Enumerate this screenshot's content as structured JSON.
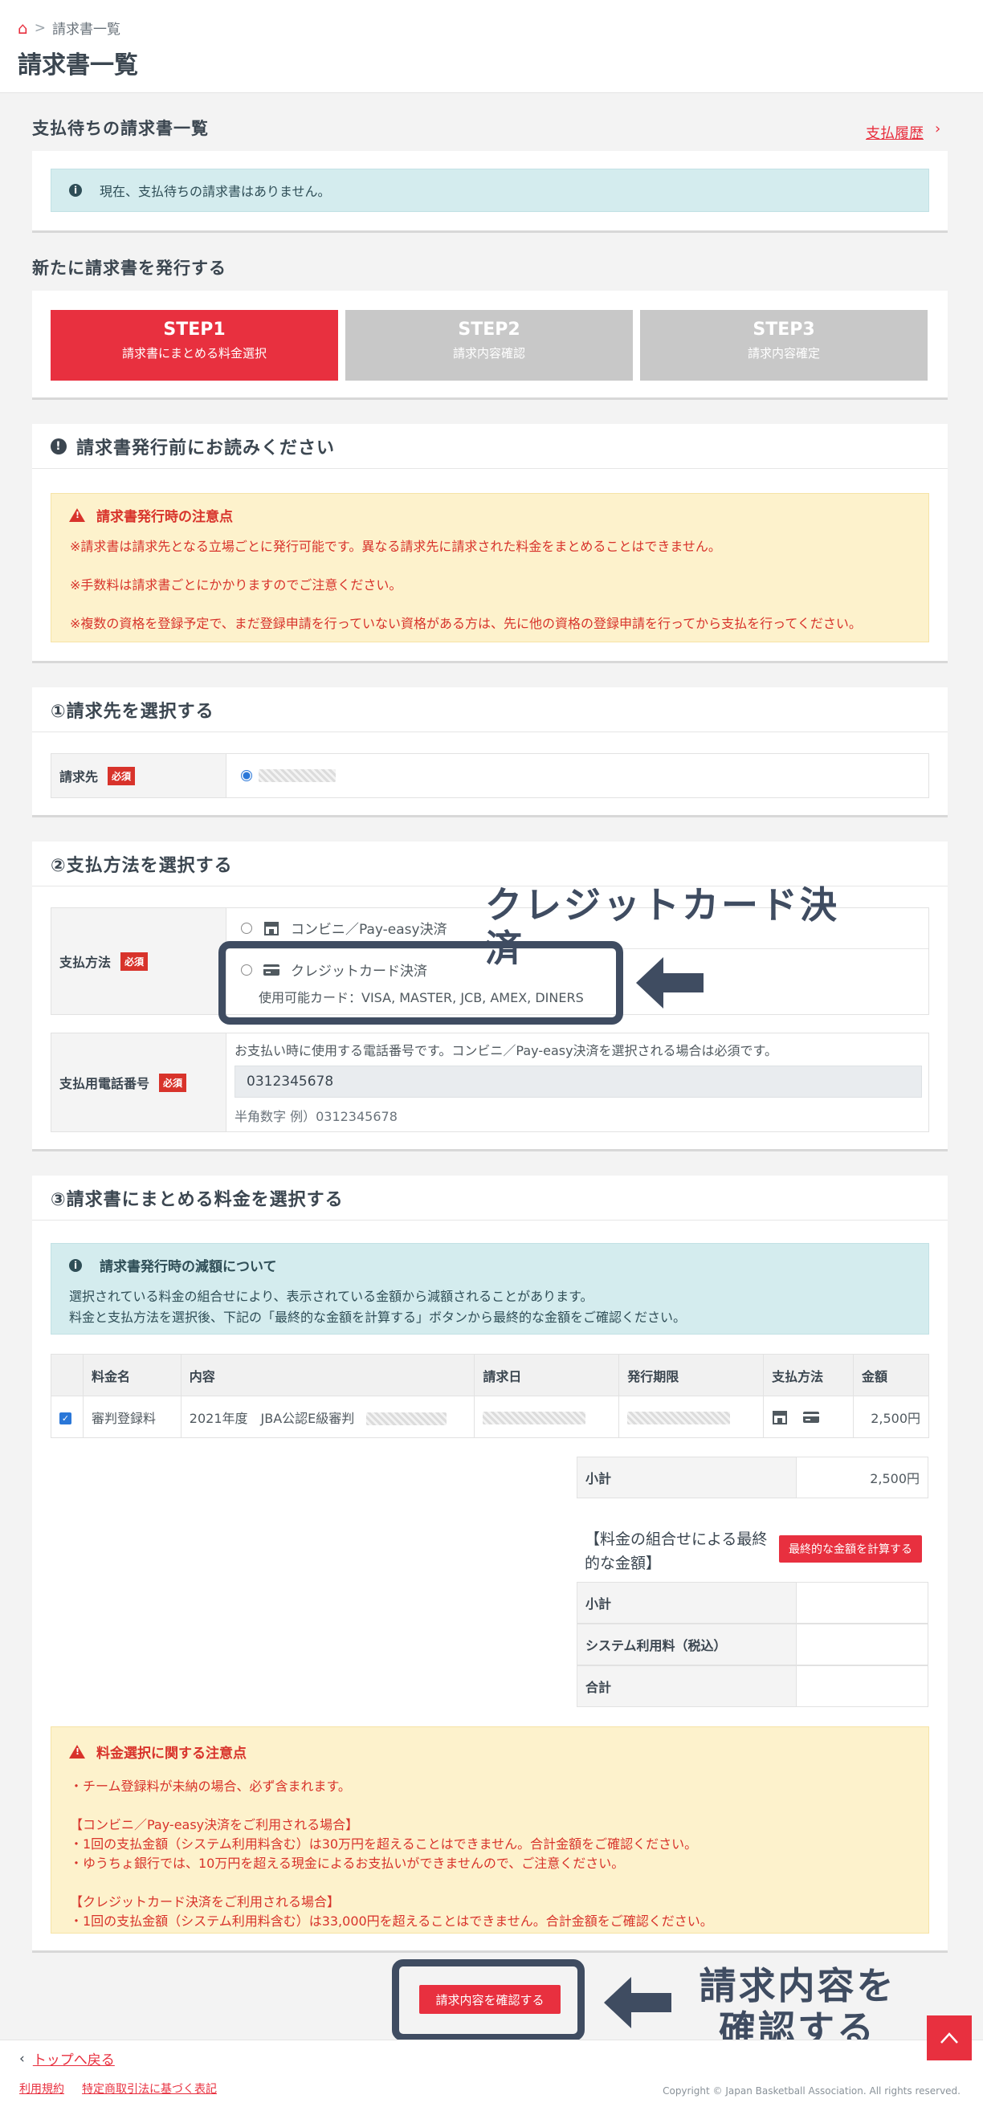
{
  "header": {
    "breadcrumb_current": "請求書一覧",
    "title": "請求書一覧"
  },
  "pending": {
    "title": "支払待ちの請求書一覧",
    "history_link": "支払履歴",
    "empty_message": "現在、支払待ちの請求書はありません。"
  },
  "issue": {
    "title": "新たに請求書を発行する",
    "steps": [
      {
        "label": "STEP1",
        "sub": "請求書にまとめる料金選択"
      },
      {
        "label": "STEP2",
        "sub": "請求内容確認"
      },
      {
        "label": "STEP3",
        "sub": "請求内容確定"
      }
    ]
  },
  "notice": {
    "title": "請求書発行前にお読みください",
    "warn_title": "請求書発行時の注意点",
    "lines": [
      "※請求書は請求先となる立場ごとに発行可能です。異なる請求先に請求された料金をまとめることはできません。",
      "※手数料は請求書ごとにかかりますのでご注意ください。",
      "※複数の資格を登録予定で、まだ登録申請を行っていない資格がある方は、先に他の資格の登録申請を行ってから支払を行ってください。"
    ]
  },
  "billing_target": {
    "title": "①請求先を選択する",
    "label": "請求先",
    "required": "必須"
  },
  "payment": {
    "title": "②支払方法を選択する",
    "label": "支払方法",
    "required": "必須",
    "option_convenience": "コンビニ／Pay-easy決済",
    "option_credit": "クレジットカード決済",
    "credit_cards": "使用可能カード：VISA, MASTER, JCB, AMEX, DINERS",
    "phone_label": "支払用電話番号",
    "phone_note": "お支払い時に使用する電話番号です。コンビニ／Pay-easy決済を選択される場合は必須です。",
    "phone_value": "0312345678",
    "phone_hint": "半角数字 例）0312345678"
  },
  "fees": {
    "title": "③請求書にまとめる料金を選択する",
    "info_title": "請求書発行時の減額について",
    "info_line1": "選択されている料金の組合せにより、表示されている金額から減額されることがあります。",
    "info_line2": "料金と支払方法を選択後、下記の「最終的な金額を計算する」ボタンから最終的な金額をご確認ください。",
    "columns": [
      "料金名",
      "内容",
      "請求日",
      "発行期限",
      "支払方法",
      "金額"
    ],
    "row": {
      "name": "審判登録料",
      "content": "2021年度　JBA公認E級審判",
      "amount": "2,500円"
    },
    "subtotal_label": "小計",
    "subtotal_value": "2,500円",
    "final_label": "【料金の組合せによる最終的な金額】",
    "calc_button": "最終的な金額を計算する",
    "final_subtotal": "小計",
    "system_fee": "システム利用料（税込）",
    "total": "合計"
  },
  "fee_notice": {
    "title": "料金選択に関する注意点",
    "l1": "・チーム登録料が未納の場合、必ず含まれます。",
    "l2": "【コンビニ／Pay-easy決済をご利用される場合】",
    "l3": "・1回の支払金額（システム利用料含む）は30万円を超えることはできません。合計金額をご確認ください。",
    "l4": "・ゆうちょ銀行では、10万円を超える現金によるお支払いができませんので、ご注意ください。",
    "l5": "【クレジットカード決済をご利用される場合】",
    "l6": "・1回の支払金額（システム利用料含む）は33,000円を超えることはできません。合計金額をご確認ください。"
  },
  "confirm_button": "請求内容を確認する",
  "annotations": {
    "credit": "クレジットカード決済",
    "confirm_line1": "請求内容を",
    "confirm_line2": "確認する"
  },
  "footer": {
    "back_top": "トップへ戻る",
    "terms": "利用規約",
    "commerce": "特定商取引法に基づく表記",
    "copyright": "Copyright © Japan Basketball Association. All rights reserved."
  }
}
